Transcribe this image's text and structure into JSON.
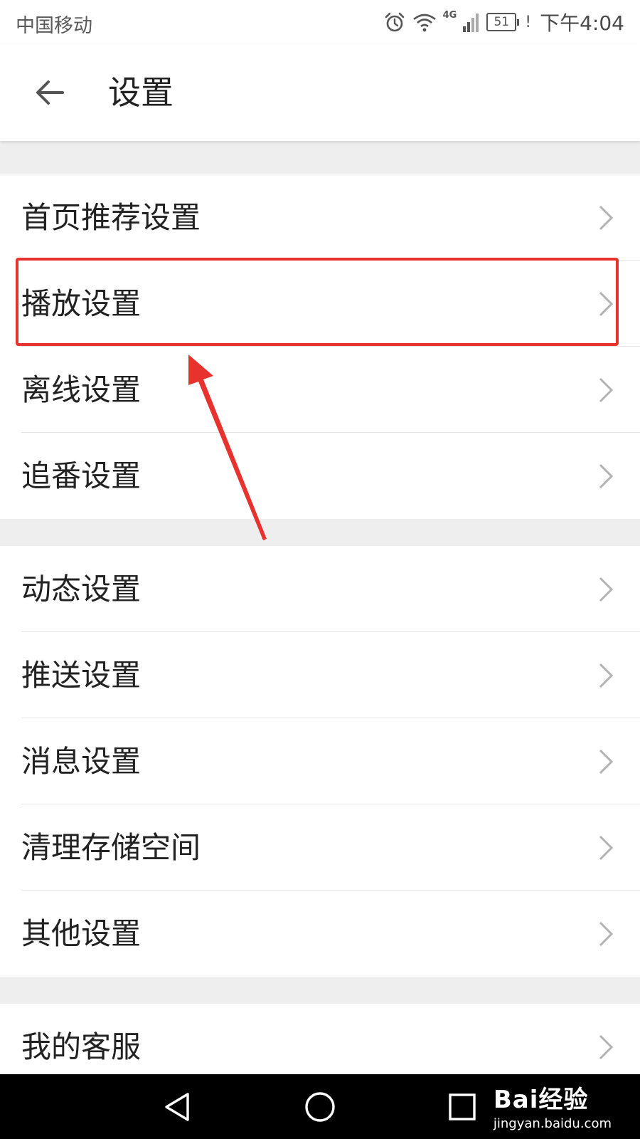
{
  "status_bar": {
    "carrier": "中国移动",
    "network": "4G",
    "battery": "51",
    "alert": "!",
    "time": "下午4:04"
  },
  "app_bar": {
    "title": "设置",
    "back_icon": "arrow-left-icon"
  },
  "groups": [
    {
      "items": [
        {
          "label": "首页推荐设置"
        },
        {
          "label": "播放设置"
        },
        {
          "label": "离线设置"
        },
        {
          "label": "追番设置"
        }
      ]
    },
    {
      "items": [
        {
          "label": "动态设置"
        },
        {
          "label": "推送设置"
        },
        {
          "label": "消息设置"
        },
        {
          "label": "清理存储空间"
        },
        {
          "label": "其他设置"
        }
      ]
    },
    {
      "items": [
        {
          "label": "我的客服"
        }
      ]
    }
  ],
  "watermark": {
    "brand": "Bai经验",
    "url": "jingyan.baidu.com"
  },
  "colors": {
    "highlight": "#e8322d",
    "section_gap": "#eeeeee",
    "text": "#222222",
    "chevron": "#b3b3b3"
  }
}
